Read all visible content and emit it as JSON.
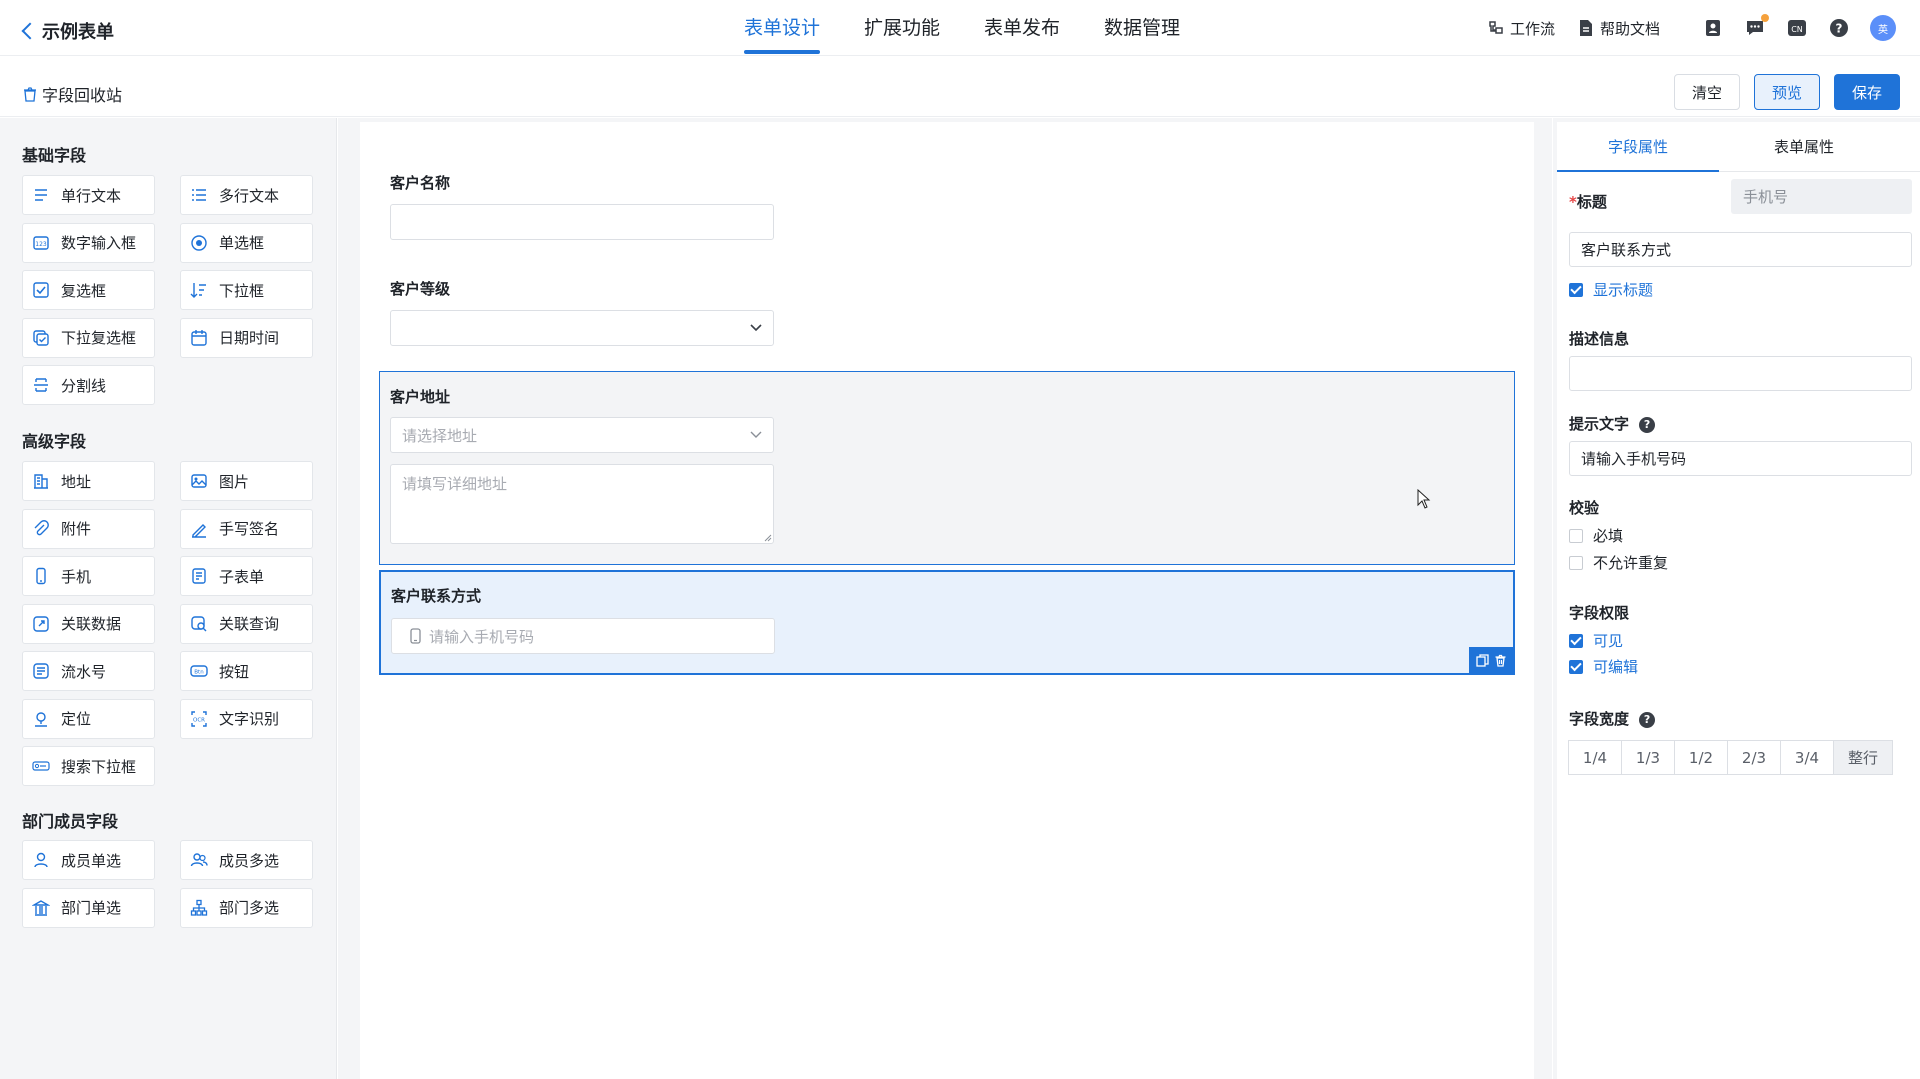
{
  "header": {
    "back_title": "示例表单",
    "tabs": [
      {
        "label": "表单设计"
      },
      {
        "label": "扩展功能"
      },
      {
        "label": "表单发布"
      },
      {
        "label": "数据管理"
      }
    ],
    "workflow": "工作流",
    "help_doc": "帮助文档",
    "avatar_text": "英",
    "lang_badge": "CN"
  },
  "toolbar": {
    "recycle": "字段回收站",
    "clear": "清空",
    "preview": "预览",
    "save": "保存"
  },
  "palette": {
    "basic_title": "基础字段",
    "basic": [
      {
        "label": "单行文本",
        "icon": "single-line-text-icon"
      },
      {
        "label": "多行文本",
        "icon": "multi-line-text-icon"
      },
      {
        "label": "数字输入框",
        "icon": "number-input-icon"
      },
      {
        "label": "单选框",
        "icon": "radio-icon"
      },
      {
        "label": "复选框",
        "icon": "checkbox-icon"
      },
      {
        "label": "下拉框",
        "icon": "dropdown-icon"
      },
      {
        "label": "下拉复选框",
        "icon": "dropdown-checkbox-icon"
      },
      {
        "label": "日期时间",
        "icon": "calendar-icon"
      },
      {
        "label": "分割线",
        "icon": "divider-icon"
      }
    ],
    "advanced_title": "高级字段",
    "advanced": [
      {
        "label": "地址",
        "icon": "address-icon"
      },
      {
        "label": "图片",
        "icon": "image-icon"
      },
      {
        "label": "附件",
        "icon": "attachment-icon"
      },
      {
        "label": "手写签名",
        "icon": "signature-icon"
      },
      {
        "label": "手机",
        "icon": "phone-icon"
      },
      {
        "label": "子表单",
        "icon": "subform-icon"
      },
      {
        "label": "关联数据",
        "icon": "link-data-icon"
      },
      {
        "label": "关联查询",
        "icon": "link-query-icon"
      },
      {
        "label": "流水号",
        "icon": "serial-number-icon"
      },
      {
        "label": "按钮",
        "icon": "button-icon"
      },
      {
        "label": "定位",
        "icon": "location-icon"
      },
      {
        "label": "文字识别",
        "icon": "ocr-icon"
      },
      {
        "label": "搜索下拉框",
        "icon": "search-dropdown-icon"
      }
    ],
    "dept_title": "部门成员字段",
    "dept": [
      {
        "label": "成员单选",
        "icon": "member-single-icon"
      },
      {
        "label": "成员多选",
        "icon": "member-multi-icon"
      },
      {
        "label": "部门单选",
        "icon": "department-single-icon"
      },
      {
        "label": "部门多选",
        "icon": "department-multi-icon"
      }
    ]
  },
  "form": {
    "customer_name": {
      "label": "客户名称"
    },
    "customer_level": {
      "label": "客户等级"
    },
    "customer_address": {
      "label": "客户地址",
      "select_placeholder": "请选择地址",
      "detail_placeholder": "请填写详细地址"
    },
    "customer_contact": {
      "label": "客户联系方式",
      "placeholder": "请输入手机号码"
    }
  },
  "props": {
    "tabs": [
      "字段属性",
      "表单属性"
    ],
    "title_label": "标题",
    "field_type": "手机号",
    "title_value": "客户联系方式",
    "show_title": "显示标题",
    "desc_label": "描述信息",
    "desc_value": "",
    "hint_label": "提示文字",
    "hint_value": "请输入手机号码",
    "validate_label": "校验",
    "required": "必填",
    "no_duplicate": "不允许重复",
    "perm_label": "字段权限",
    "visible": "可见",
    "editable": "可编辑",
    "width_label": "字段宽度",
    "widths": [
      "1/4",
      "1/3",
      "1/2",
      "2/3",
      "3/4",
      "整行"
    ]
  },
  "colors": {
    "accent": "#1f73d8",
    "selected_bg": "#e8f1fc"
  }
}
